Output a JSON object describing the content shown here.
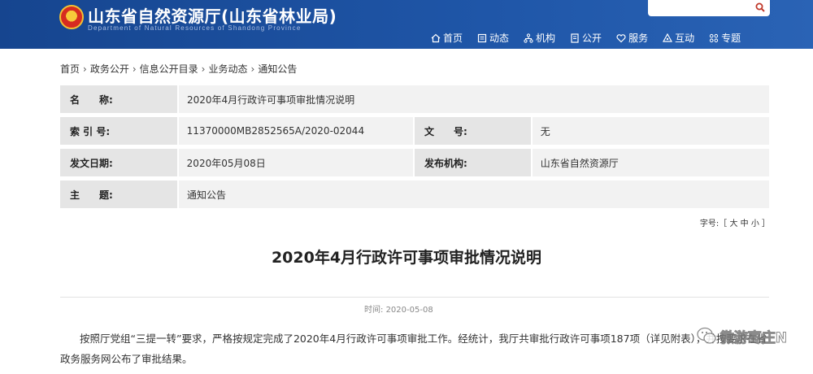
{
  "header": {
    "title": "山东省自然资源厅(山东省林业局)",
    "subtitle": "Department of Natural Resources of Shandong Province",
    "search_placeholder": "",
    "nav": [
      {
        "label": "首页",
        "icon": "home-icon"
      },
      {
        "label": "动态",
        "icon": "news-icon"
      },
      {
        "label": "机构",
        "icon": "org-icon"
      },
      {
        "label": "公开",
        "icon": "doc-icon"
      },
      {
        "label": "服务",
        "icon": "heart-icon"
      },
      {
        "label": "互动",
        "icon": "interact-icon"
      },
      {
        "label": "专题",
        "icon": "grid-icon"
      }
    ]
  },
  "breadcrumb": [
    "首页",
    "政务公开",
    "信息公开目录",
    "业务动态",
    "通知公告"
  ],
  "meta": {
    "name_label": "名　　称:",
    "name_value": "2020年4月行政许可事项审批情况说明",
    "index_label": "索 引 号:",
    "index_value": "11370000MB2852565A/2020-02044",
    "docno_label": "文　　号:",
    "docno_value": "无",
    "date_label": "发文日期:",
    "date_value": "2020年05月08日",
    "org_label": "发布机构:",
    "org_value": "山东省自然资源厅",
    "topic_label": "主　　题:",
    "topic_value": "通知公告"
  },
  "font_size": {
    "prefix": "字号:［ ",
    "large": "大",
    "medium": "中",
    "small": "小",
    "suffix": " ］"
  },
  "article": {
    "title": "2020年4月行政许可事项审批情况说明",
    "time_label": "时间:",
    "time_value": "2020-05-08",
    "body": "按照厅党组“三提一转”要求，严格按规定完成了2020年4月行政许可事项审批工作。经统计，我厅共审批行政许可事项187项（详见附表），并按要求在省政务服务网公布了审批结果。"
  },
  "watermark": {
    "text": "微游枣庄N"
  },
  "colors": {
    "header_bg": "#1f4e9a",
    "label_bg": "#e5e5e5",
    "value_bg": "#f2f2f2",
    "search_icon": "#c0392b"
  }
}
